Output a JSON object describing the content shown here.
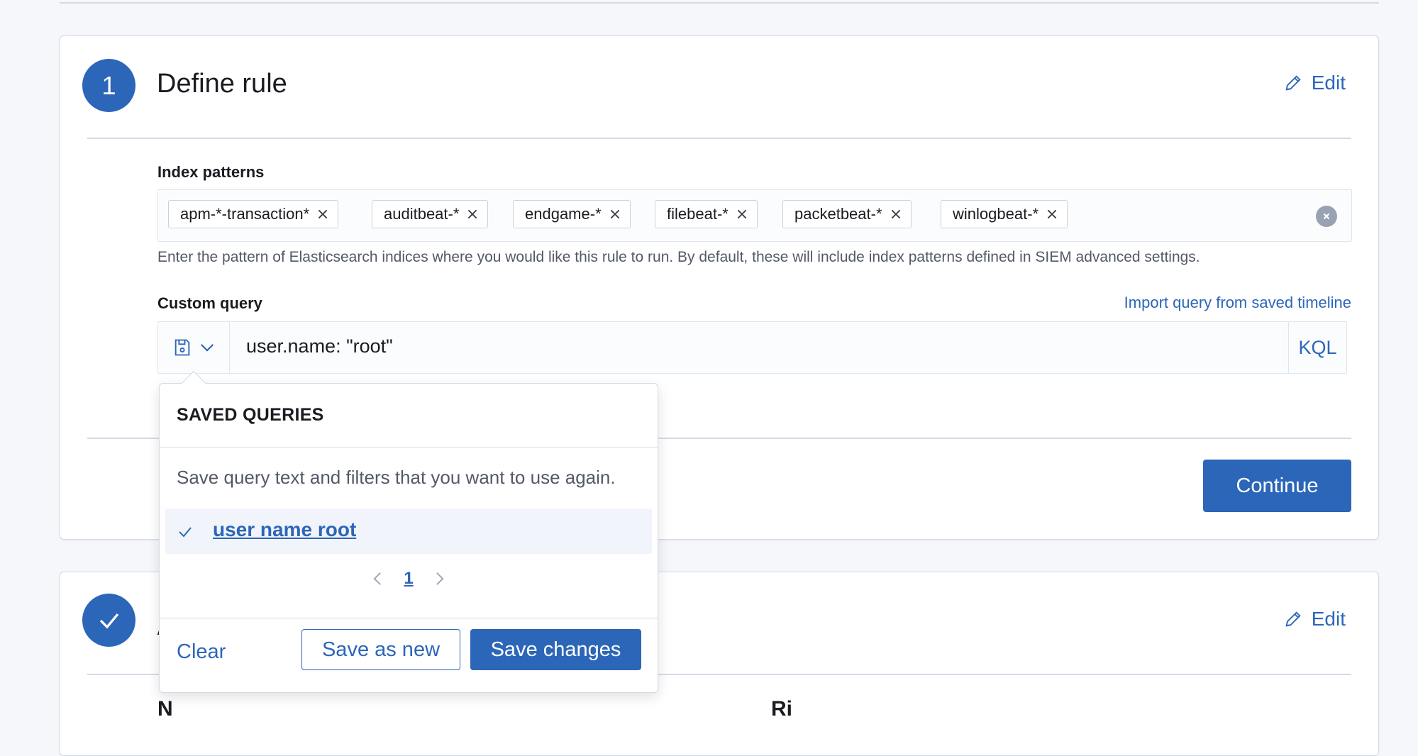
{
  "colors": {
    "primary": "#2c66b8",
    "border": "#d3dae6",
    "text": "#1a1c21",
    "subdued": "#535966"
  },
  "step1": {
    "number": "1",
    "title": "Define rule",
    "edit_label": "Edit",
    "index_patterns": {
      "label": "Index patterns",
      "tags": [
        "apm-*-transaction*",
        "auditbeat-*",
        "endgame-*",
        "filebeat-*",
        "packetbeat-*",
        "winlogbeat-*"
      ],
      "help": "Enter the pattern of Elasticsearch indices where you would like this rule to run. By default, these will include index patterns defined in SIEM advanced settings."
    },
    "custom_query": {
      "label": "Custom query",
      "import_link": "Import query from saved timeline",
      "value": "user.name: \"root\"",
      "language": "KQL"
    },
    "continue_label": "Continue"
  },
  "saved_queries": {
    "title": "SAVED QUERIES",
    "description": "Save query text and filters that you want to use again.",
    "items": [
      {
        "label": "user name root",
        "selected": true
      }
    ],
    "page": "1",
    "clear_label": "Clear",
    "save_as_new_label": "Save as new",
    "save_changes_label": "Save changes"
  },
  "step2": {
    "edit_label": "Edit",
    "partial_letter": "A",
    "partial_field_left": "N",
    "partial_field_right": "Ri"
  }
}
